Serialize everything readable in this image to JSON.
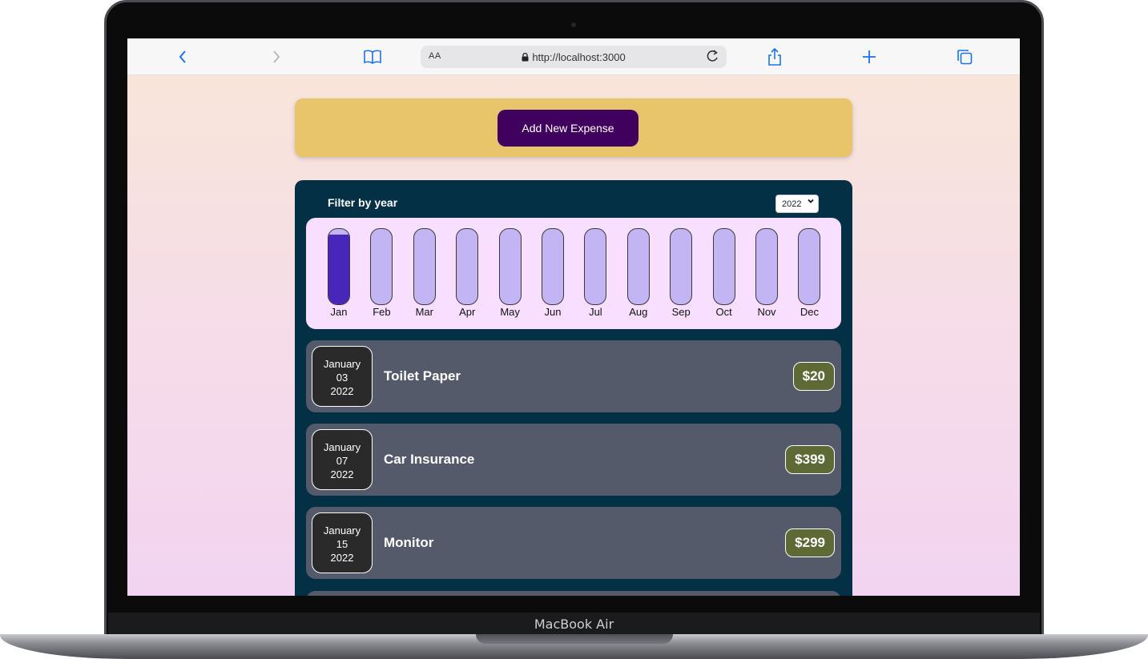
{
  "device": {
    "label": "MacBook Air"
  },
  "browser": {
    "text_size_label": "AA",
    "url": "http://localhost:3000"
  },
  "app": {
    "add_button_label": "Add New Expense",
    "filter_label": "Filter by year",
    "selected_year": "2022",
    "chart_data": {
      "type": "bar",
      "categories": [
        "Jan",
        "Feb",
        "Mar",
        "Apr",
        "May",
        "Jun",
        "Jul",
        "Aug",
        "Sep",
        "Oct",
        "Nov",
        "Dec"
      ],
      "values": [
        0.93,
        0,
        0,
        0,
        0,
        0,
        0,
        0,
        0,
        0,
        0,
        0
      ],
      "ylim": [
        0,
        1
      ]
    },
    "expenses": [
      {
        "month": "January",
        "day": "03",
        "year": "2022",
        "title": "Toilet Paper",
        "amount": "$20"
      },
      {
        "month": "January",
        "day": "07",
        "year": "2022",
        "title": "Car Insurance",
        "amount": "$399"
      },
      {
        "month": "January",
        "day": "15",
        "year": "2022",
        "title": "Monitor",
        "amount": "$299"
      }
    ]
  }
}
